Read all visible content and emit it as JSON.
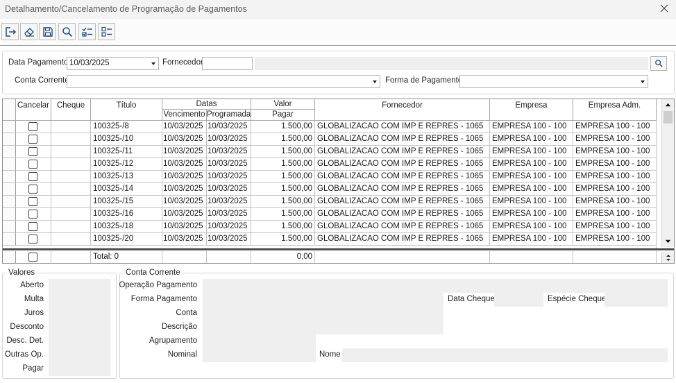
{
  "window": {
    "title": "Detalhamento/Cancelamento de Programação de Pagamentos"
  },
  "toolbar": {
    "buttons": [
      {
        "name": "exit",
        "icon": "exit-icon"
      },
      {
        "name": "clear",
        "icon": "eraser-icon"
      },
      {
        "name": "save",
        "icon": "floppy-disk-icon"
      },
      {
        "name": "search",
        "icon": "magnifier-icon"
      },
      {
        "name": "check-all",
        "icon": "checklist-checked-icon"
      },
      {
        "name": "uncheck-all",
        "icon": "checklist-unchecked-icon"
      }
    ]
  },
  "filters": {
    "data_pagamento_label": "Data Pagamento",
    "data_pagamento_value": "10/03/2025",
    "fornecedor_label": "Fornecedor",
    "fornecedor_code": "",
    "fornecedor_name": "",
    "conta_corrente_label": "Conta Corrente",
    "conta_corrente_value": "",
    "forma_pagamento_label": "Forma de Pagamento",
    "forma_pagamento_value": ""
  },
  "grid": {
    "headers": {
      "cancelar": "Cancelar",
      "cheque": "Cheque",
      "titulo": "Título",
      "datas": "Datas",
      "vencimento": "Vencimento",
      "programada": "Programada",
      "valor": "Valor",
      "pagar": "Pagar",
      "fornecedor": "Fornecedor",
      "empresa": "Empresa",
      "empresa_adm": "Empresa Adm."
    },
    "rows": [
      {
        "cancelar": false,
        "cheque": "",
        "titulo": "100325-/8",
        "vencimento": "10/03/2025",
        "programada": "10/03/2025",
        "valor": "1.500,00",
        "fornecedor": "GLOBALIZACAO COM IMP E REPRES - 1065",
        "empresa": "EMPRESA 100 - 100",
        "empresa_adm": "EMPRESA 100 - 100"
      },
      {
        "cancelar": false,
        "cheque": "",
        "titulo": "100325-/10",
        "vencimento": "10/03/2025",
        "programada": "10/03/2025",
        "valor": "1.500,00",
        "fornecedor": "GLOBALIZACAO COM IMP E REPRES - 1065",
        "empresa": "EMPRESA 100 - 100",
        "empresa_adm": "EMPRESA 100 - 100"
      },
      {
        "cancelar": false,
        "cheque": "",
        "titulo": "100325-/11",
        "vencimento": "10/03/2025",
        "programada": "10/03/2025",
        "valor": "1.500,00",
        "fornecedor": "GLOBALIZACAO COM IMP E REPRES - 1065",
        "empresa": "EMPRESA 100 - 100",
        "empresa_adm": "EMPRESA 100 - 100"
      },
      {
        "cancelar": false,
        "cheque": "",
        "titulo": "100325-/12",
        "vencimento": "10/03/2025",
        "programada": "10/03/2025",
        "valor": "1.500,00",
        "fornecedor": "GLOBALIZACAO COM IMP E REPRES - 1065",
        "empresa": "EMPRESA 100 - 100",
        "empresa_adm": "EMPRESA 100 - 100"
      },
      {
        "cancelar": false,
        "cheque": "",
        "titulo": "100325-/13",
        "vencimento": "10/03/2025",
        "programada": "10/03/2025",
        "valor": "1.500,00",
        "fornecedor": "GLOBALIZACAO COM IMP E REPRES - 1065",
        "empresa": "EMPRESA 100 - 100",
        "empresa_adm": "EMPRESA 100 - 100"
      },
      {
        "cancelar": false,
        "cheque": "",
        "titulo": "100325-/14",
        "vencimento": "10/03/2025",
        "programada": "10/03/2025",
        "valor": "1.500,00",
        "fornecedor": "GLOBALIZACAO COM IMP E REPRES - 1065",
        "empresa": "EMPRESA 100 - 100",
        "empresa_adm": "EMPRESA 100 - 100"
      },
      {
        "cancelar": false,
        "cheque": "",
        "titulo": "100325-/15",
        "vencimento": "10/03/2025",
        "programada": "10/03/2025",
        "valor": "1.500,00",
        "fornecedor": "GLOBALIZACAO COM IMP E REPRES - 1065",
        "empresa": "EMPRESA 100 - 100",
        "empresa_adm": "EMPRESA 100 - 100"
      },
      {
        "cancelar": false,
        "cheque": "",
        "titulo": "100325-/16",
        "vencimento": "10/03/2025",
        "programada": "10/03/2025",
        "valor": "1.500,00",
        "fornecedor": "GLOBALIZACAO COM IMP E REPRES - 1065",
        "empresa": "EMPRESA 100 - 100",
        "empresa_adm": "EMPRESA 100 - 100"
      },
      {
        "cancelar": false,
        "cheque": "",
        "titulo": "100325-/18",
        "vencimento": "10/03/2025",
        "programada": "10/03/2025",
        "valor": "1.500,00",
        "fornecedor": "GLOBALIZACAO COM IMP E REPRES - 1065",
        "empresa": "EMPRESA 100 - 100",
        "empresa_adm": "EMPRESA 100 - 100"
      },
      {
        "cancelar": false,
        "cheque": "",
        "titulo": "100325-/20",
        "vencimento": "10/03/2025",
        "programada": "10/03/2025",
        "valor": "1.500,00",
        "fornecedor": "GLOBALIZACAO COM IMP E REPRES - 1065",
        "empresa": "EMPRESA 100 - 100",
        "empresa_adm": "EMPRESA 100 - 100"
      }
    ],
    "totals": {
      "cancelar": false,
      "titulo": "Total: 0",
      "valor": "0,00"
    }
  },
  "valores": {
    "legend": "Valores",
    "fields": [
      {
        "label": "Aberto",
        "value": ""
      },
      {
        "label": "Multa",
        "value": ""
      },
      {
        "label": "Juros",
        "value": ""
      },
      {
        "label": "Desconto",
        "value": ""
      },
      {
        "label": "Desc. Det.",
        "value": ""
      },
      {
        "label": "Outras Op.",
        "value": ""
      },
      {
        "label": "Pagar",
        "value": ""
      }
    ]
  },
  "conta_corrente": {
    "legend": "Conta Corrente",
    "operacao_pagamento_label": "Operação Pagamento",
    "forma_pagamento_label": "Forma Pagamento",
    "conta_label": "Conta",
    "descricao_label": "Descrição",
    "agrupamento_label": "Agrupamento",
    "nominal_label": "Nominal",
    "data_cheque_label": "Data Cheque",
    "especie_cheque_label": "Espécie Cheque",
    "nome_label": "Nome"
  },
  "colors": {
    "field_gray": "#efefef",
    "border": "#b5b5b5",
    "title_text": "#5c5c5c"
  }
}
